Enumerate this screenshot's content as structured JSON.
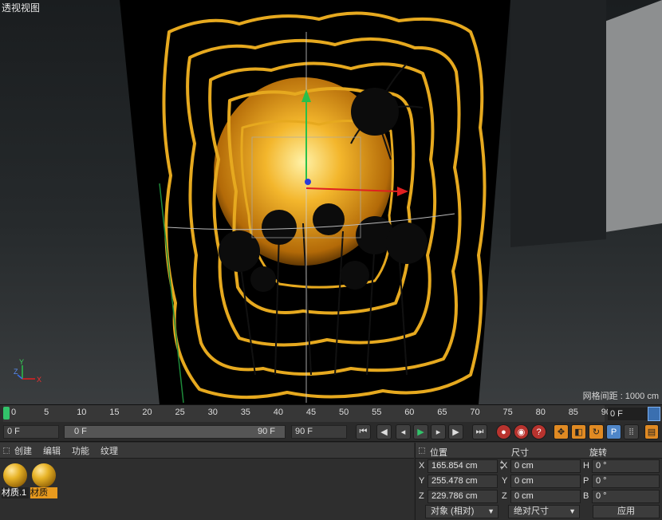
{
  "viewport": {
    "title": "透视视图",
    "grid_spacing": "网格间距 : 1000 cm",
    "axis_y": "Y",
    "axis_z": "Z",
    "axis_x": "X"
  },
  "timeline": {
    "ticks": [
      "0",
      "5",
      "10",
      "15",
      "20",
      "25",
      "30",
      "35",
      "40",
      "45",
      "50",
      "55",
      "60",
      "65",
      "70",
      "75",
      "80",
      "85",
      "90"
    ],
    "current_frame": "0 F"
  },
  "transport": {
    "start_frame": "0 F",
    "range_start": "0 F",
    "range_end": "90 F",
    "end_frame": "90 F"
  },
  "materials": {
    "menu": [
      "创建",
      "编辑",
      "功能",
      "纹理"
    ],
    "items": [
      {
        "label": "材质.1",
        "selected": false
      },
      {
        "label": "材质",
        "selected": true
      }
    ]
  },
  "coords": {
    "headers": {
      "position": "位置",
      "size": "尺寸",
      "rotation": "旋转"
    },
    "rows": [
      {
        "axis": "X",
        "pos": "165.854 cm",
        "size_axis": "X",
        "size": "0 cm",
        "rot_axis": "H",
        "rot": "0 °"
      },
      {
        "axis": "Y",
        "pos": "255.478 cm",
        "size_axis": "Y",
        "size": "0 cm",
        "rot_axis": "P",
        "rot": "0 °"
      },
      {
        "axis": "Z",
        "pos": "229.786 cm",
        "size_axis": "Z",
        "size": "0 cm",
        "rot_axis": "B",
        "rot": "0 °"
      }
    ],
    "mode_dropdown": "对象 (相对)",
    "size_dropdown": "绝对尺寸",
    "apply_label": "应用"
  },
  "colors": {
    "accent_green": "#32c36a",
    "selected_orange": "#e89a1e",
    "gold": "#e6a91f"
  }
}
